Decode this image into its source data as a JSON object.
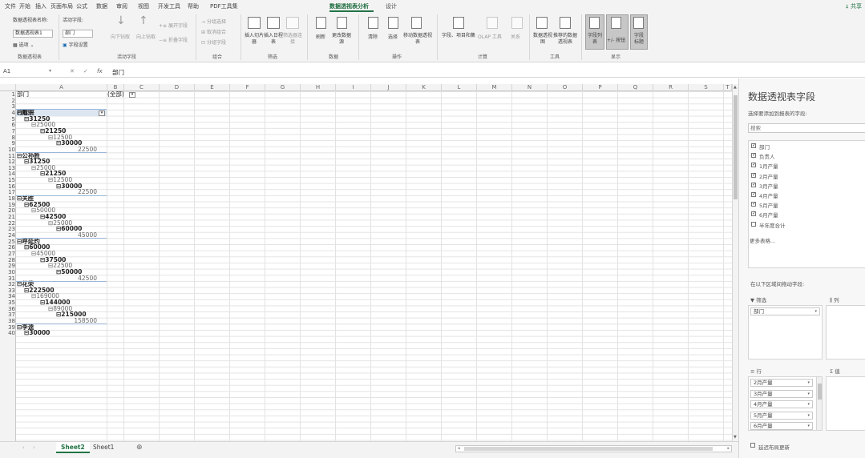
{
  "menu": {
    "tabs": [
      "文件",
      "开始",
      "插入",
      "页面布局",
      "公式",
      "数据",
      "审阅",
      "视图",
      "开发工具",
      "帮助",
      "PDF工具集",
      "数据透视表分析",
      "设计"
    ],
    "active_tab": "数据透视表分析",
    "share": "共享"
  },
  "ribbon": {
    "pivot_name_label": "数据透视表名称:",
    "pivot_name_value": "数据透视表1",
    "options_label": "选项",
    "group_pivot": "数据透视表",
    "active_field_label": "活动字段:",
    "active_field_value": "部门",
    "field_settings": "字段设置",
    "drill_down": "向下钻取",
    "drill_up": "向上钻取",
    "expand_field": "展开字段",
    "collapse_field": "折叠字段",
    "group_active_field": "活动字段",
    "group_selection": "分组选择",
    "ungroup": "取消组合",
    "group_field": "分组字段",
    "group_group": "组合",
    "insert_slicer": "插入切片器",
    "insert_timeline": "插入日程表",
    "filter_connections": "筛选器连接",
    "group_filter": "筛选",
    "refresh": "刷新",
    "change_source": "更改数据源",
    "group_data": "数据",
    "clear": "清除",
    "select": "选择",
    "move_pivot": "移动数据透视表",
    "group_actions": "操作",
    "fields_items_sets": "字段、项目和集",
    "olap_tools": "OLAP 工具",
    "relationships": "关系",
    "group_calc": "计算",
    "pivot_chart": "数据透视图",
    "recommended": "推荐的数据透视表",
    "group_tools": "工具",
    "field_list": "字段列表",
    "buttons": "+/- 按钮",
    "field_headers": "字段标题",
    "group_show": "显示"
  },
  "formula_bar": {
    "name_box": "A1",
    "fx": "fx",
    "content": "部门"
  },
  "columns": [
    "A",
    "B",
    "C",
    "D",
    "E",
    "F",
    "G",
    "H",
    "I",
    "J",
    "K",
    "L",
    "M",
    "N",
    "O",
    "P",
    "Q",
    "R",
    "S",
    "T"
  ],
  "rows": [
    "1",
    "2",
    "3",
    "4",
    "5",
    "6",
    "7",
    "8",
    "9",
    "10",
    "11",
    "12",
    "13",
    "14",
    "15",
    "16",
    "17",
    "18",
    "19",
    "20",
    "21",
    "22",
    "23",
    "24",
    "25",
    "26",
    "27",
    "28",
    "29",
    "30",
    "31",
    "32",
    "33",
    "34",
    "35",
    "36",
    "37",
    "38",
    "39",
    "40"
  ],
  "pivot": {
    "filter_label": "部门",
    "filter_value": "(全部)",
    "row_labels": "行标签",
    "lines": [
      {
        "text": "⊟戴宗",
        "indent": 0,
        "bold": true
      },
      {
        "text": "⊟31250",
        "indent": 1,
        "bold": true
      },
      {
        "text": "⊟25000",
        "indent": 2,
        "bold": false
      },
      {
        "text": "⊟21250",
        "indent": 3,
        "bold": true
      },
      {
        "text": "⊟12500",
        "indent": 4,
        "bold": false
      },
      {
        "text": "⊟30000",
        "indent": 5,
        "bold": true
      },
      {
        "text": "22500",
        "indent": 6,
        "bold": false
      },
      {
        "text": "⊟公孙胜",
        "indent": 0,
        "bold": true
      },
      {
        "text": "⊟31250",
        "indent": 1,
        "bold": true
      },
      {
        "text": "⊟25000",
        "indent": 2,
        "bold": false
      },
      {
        "text": "⊟21250",
        "indent": 3,
        "bold": true
      },
      {
        "text": "⊟12500",
        "indent": 4,
        "bold": false
      },
      {
        "text": "⊟30000",
        "indent": 5,
        "bold": true
      },
      {
        "text": "22500",
        "indent": 6,
        "bold": false
      },
      {
        "text": "⊟关胜",
        "indent": 0,
        "bold": true
      },
      {
        "text": "⊟62500",
        "indent": 1,
        "bold": true
      },
      {
        "text": "⊟50000",
        "indent": 2,
        "bold": false
      },
      {
        "text": "⊟42500",
        "indent": 3,
        "bold": true
      },
      {
        "text": "⊟25000",
        "indent": 4,
        "bold": false
      },
      {
        "text": "⊟60000",
        "indent": 5,
        "bold": true
      },
      {
        "text": "45000",
        "indent": 6,
        "bold": false
      },
      {
        "text": "⊟呼延灼",
        "indent": 0,
        "bold": true
      },
      {
        "text": "⊟60000",
        "indent": 1,
        "bold": true
      },
      {
        "text": "⊟45000",
        "indent": 2,
        "bold": false
      },
      {
        "text": "⊟37500",
        "indent": 3,
        "bold": true
      },
      {
        "text": "⊟22500",
        "indent": 4,
        "bold": false
      },
      {
        "text": "⊟50000",
        "indent": 5,
        "bold": true
      },
      {
        "text": "42500",
        "indent": 6,
        "bold": false
      },
      {
        "text": "⊟花荣",
        "indent": 0,
        "bold": true
      },
      {
        "text": "⊟222500",
        "indent": 1,
        "bold": true
      },
      {
        "text": "⊟169000",
        "indent": 2,
        "bold": false
      },
      {
        "text": "⊟144000",
        "indent": 3,
        "bold": true
      },
      {
        "text": "⊟89000",
        "indent": 4,
        "bold": false
      },
      {
        "text": "⊟215000",
        "indent": 5,
        "bold": true
      },
      {
        "text": "158500",
        "indent": 6,
        "bold": false
      },
      {
        "text": "⊟李逵",
        "indent": 0,
        "bold": true
      },
      {
        "text": "⊟30000",
        "indent": 1,
        "bold": true
      }
    ]
  },
  "sheets": [
    "Sheet2",
    "Sheet1"
  ],
  "active_sheet": "Sheet2",
  "add_sheet": "⊕",
  "pane": {
    "title": "数据透视表字段",
    "choose_label": "选择要添加到报表的字段:",
    "search_placeholder": "搜索",
    "fields": [
      {
        "name": "部门",
        "checked": true
      },
      {
        "name": "负责人",
        "checked": true
      },
      {
        "name": "1月产量",
        "checked": true
      },
      {
        "name": "2月产量",
        "checked": true
      },
      {
        "name": "3月产量",
        "checked": true
      },
      {
        "name": "4月产量",
        "checked": true
      },
      {
        "name": "5月产量",
        "checked": true
      },
      {
        "name": "6月产量",
        "checked": true
      },
      {
        "name": "半年度合计",
        "checked": false
      }
    ],
    "more_tables": "更多表格...",
    "drag_label": "在以下区域间拖动字段:",
    "filter_area": "筛选",
    "columns_area": "列",
    "rows_area": "行",
    "values_area": "值",
    "filter_items": [
      "部门"
    ],
    "row_items": [
      "2月产量",
      "3月产量",
      "4月产量",
      "5月产量",
      "6月产量"
    ],
    "defer": "延迟布局更新"
  }
}
